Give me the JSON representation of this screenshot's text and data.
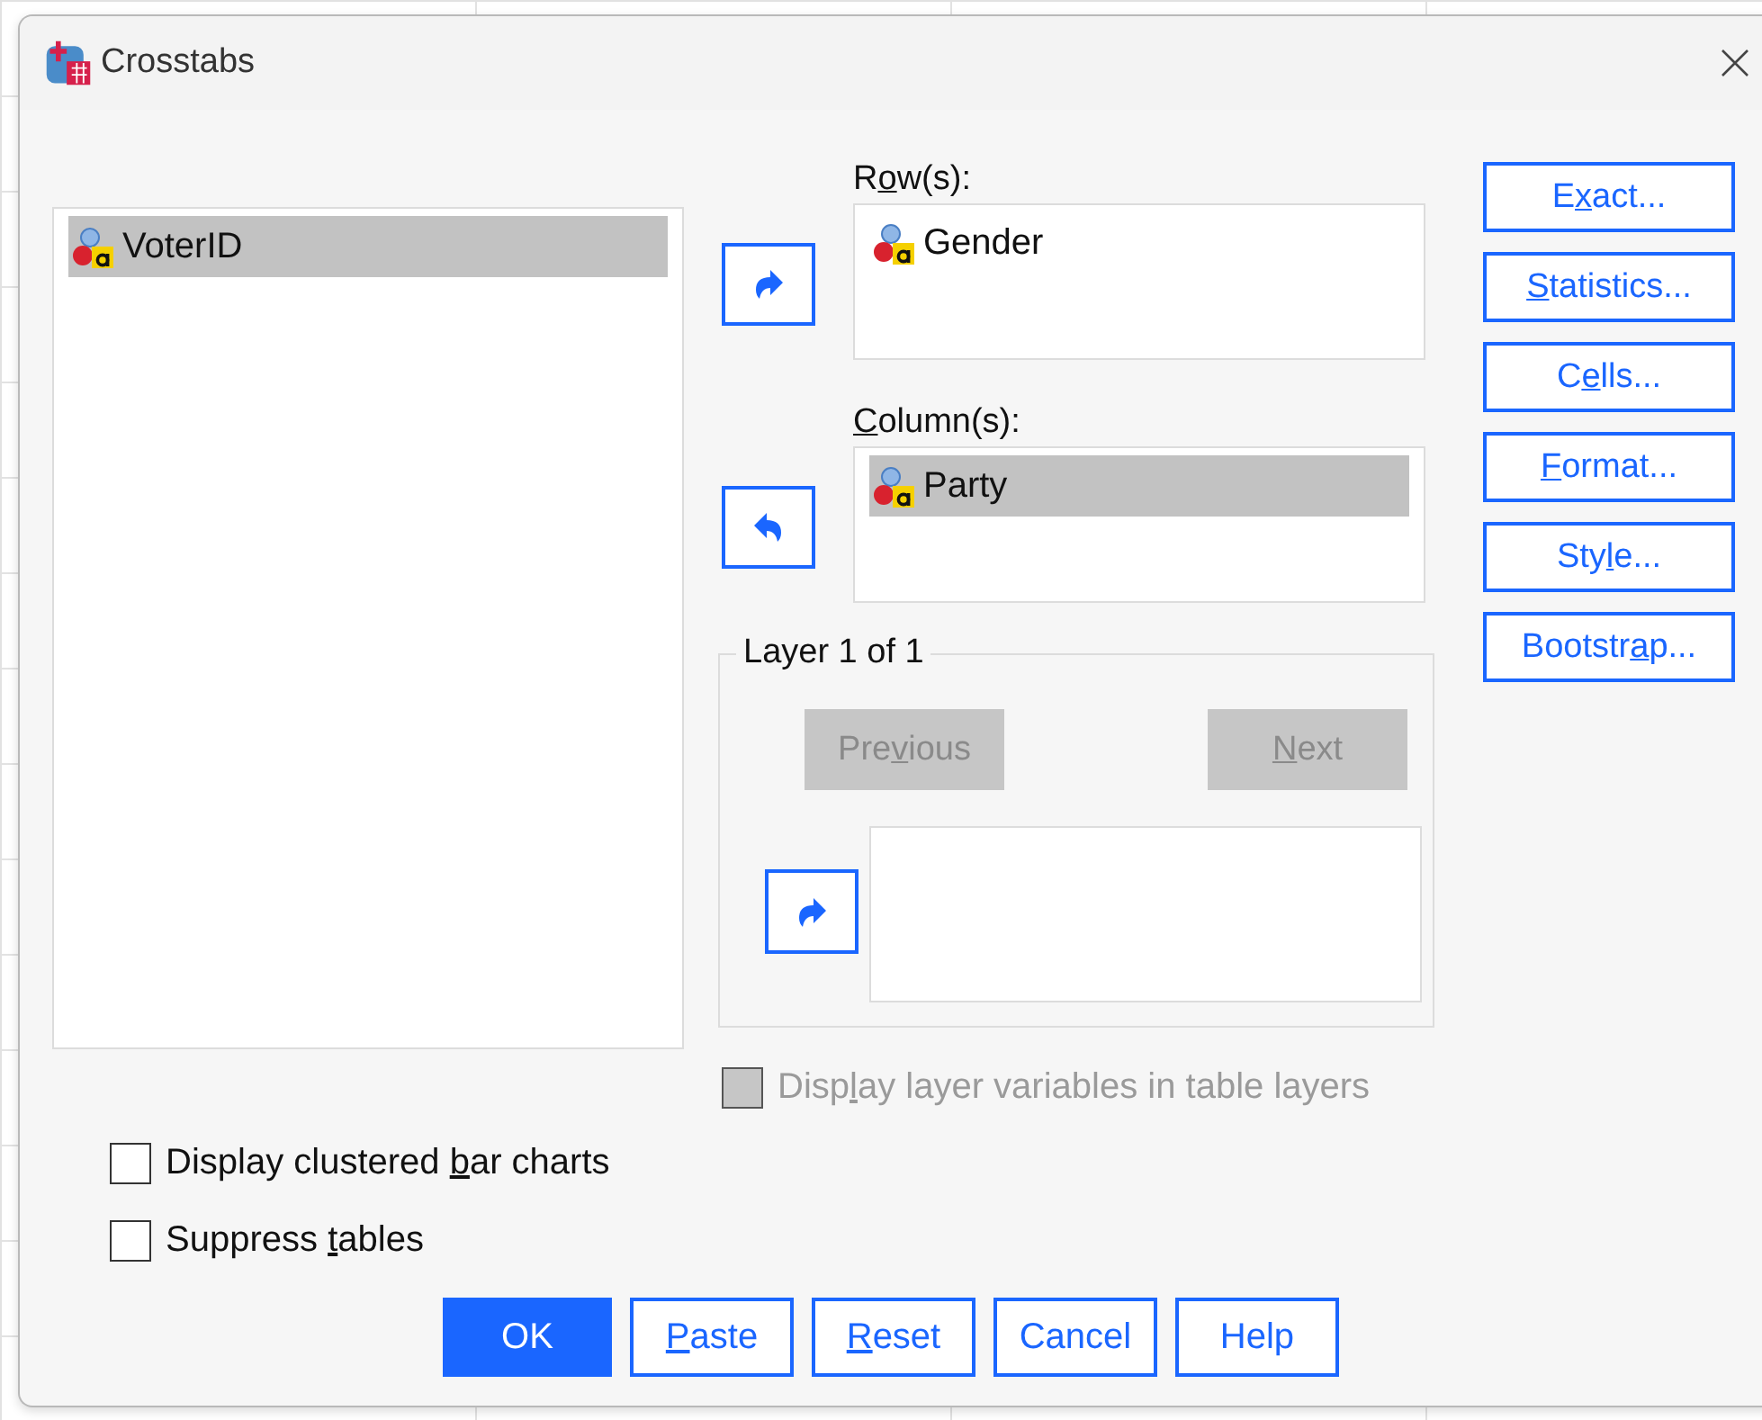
{
  "window": {
    "title": "Crosstabs"
  },
  "source_variables": [
    {
      "name": "VoterID",
      "selected": true
    }
  ],
  "rows": {
    "label": [
      {
        "text": "R",
        "underline": false
      },
      {
        "text": "o",
        "underline": true
      },
      {
        "text": "w(s):",
        "underline": false
      }
    ],
    "move_button": {
      "kind": "right"
    },
    "variables": [
      {
        "name": "Gender",
        "selected": false
      }
    ]
  },
  "columns": {
    "label": [
      {
        "text": "C",
        "underline": true
      },
      {
        "text": "olumn(s):",
        "underline": false
      }
    ],
    "move_button": {
      "kind": "left"
    },
    "variables": [
      {
        "name": "Party",
        "selected": true
      }
    ]
  },
  "layer": {
    "title": "Layer 1 of 1",
    "previous": {
      "label": [
        {
          "text": "Pre",
          "underline": false
        },
        {
          "text": "v",
          "underline": true
        },
        {
          "text": "ious",
          "underline": false
        }
      ],
      "disabled": true
    },
    "next": {
      "label": [
        {
          "text": "N",
          "underline": true
        },
        {
          "text": "ext",
          "underline": false
        }
      ],
      "disabled": true
    },
    "move_button": {
      "kind": "right"
    }
  },
  "display_layer_variables": {
    "label": [
      {
        "text": "Disp",
        "underline": false
      },
      {
        "text": "l",
        "underline": true
      },
      {
        "text": "ay layer variables in table layers",
        "underline": false
      }
    ],
    "checked": false,
    "disabled": true
  },
  "options": [
    {
      "label": [
        {
          "text": "Display clustered ",
          "underline": false
        },
        {
          "text": "b",
          "underline": true
        },
        {
          "text": "ar charts",
          "underline": false
        }
      ],
      "checked": false,
      "disabled": false
    },
    {
      "label": [
        {
          "text": "Suppress ",
          "underline": false
        },
        {
          "text": "t",
          "underline": true
        },
        {
          "text": "ables",
          "underline": false
        }
      ],
      "checked": false,
      "disabled": false
    }
  ],
  "side_buttons": [
    {
      "label": [
        {
          "text": "E",
          "underline": false
        },
        {
          "text": "x",
          "underline": true
        },
        {
          "text": "act...",
          "underline": false
        }
      ]
    },
    {
      "label": [
        {
          "text": "S",
          "underline": true
        },
        {
          "text": "tatistics...",
          "underline": false
        }
      ]
    },
    {
      "label": [
        {
          "text": "C",
          "underline": false
        },
        {
          "text": "e",
          "underline": true
        },
        {
          "text": "lls...",
          "underline": false
        }
      ]
    },
    {
      "label": [
        {
          "text": "F",
          "underline": true
        },
        {
          "text": "ormat...",
          "underline": false
        }
      ]
    },
    {
      "label": [
        {
          "text": "Sty",
          "underline": false
        },
        {
          "text": "l",
          "underline": true
        },
        {
          "text": "e...",
          "underline": false
        }
      ]
    },
    {
      "label": [
        {
          "text": "Bootstr",
          "underline": false
        },
        {
          "text": "a",
          "underline": true
        },
        {
          "text": "p...",
          "underline": false
        }
      ]
    }
  ],
  "footer_buttons": [
    {
      "label": [
        {
          "text": "OK",
          "underline": false
        }
      ],
      "default": true
    },
    {
      "label": [
        {
          "text": "P",
          "underline": true
        },
        {
          "text": "aste",
          "underline": false
        }
      ],
      "default": false
    },
    {
      "label": [
        {
          "text": "R",
          "underline": true
        },
        {
          "text": "eset",
          "underline": false
        }
      ],
      "default": false
    },
    {
      "label": [
        {
          "text": "Cancel",
          "underline": false
        }
      ],
      "default": false
    },
    {
      "label": [
        {
          "text": "Help",
          "underline": false
        }
      ],
      "default": false
    }
  ]
}
